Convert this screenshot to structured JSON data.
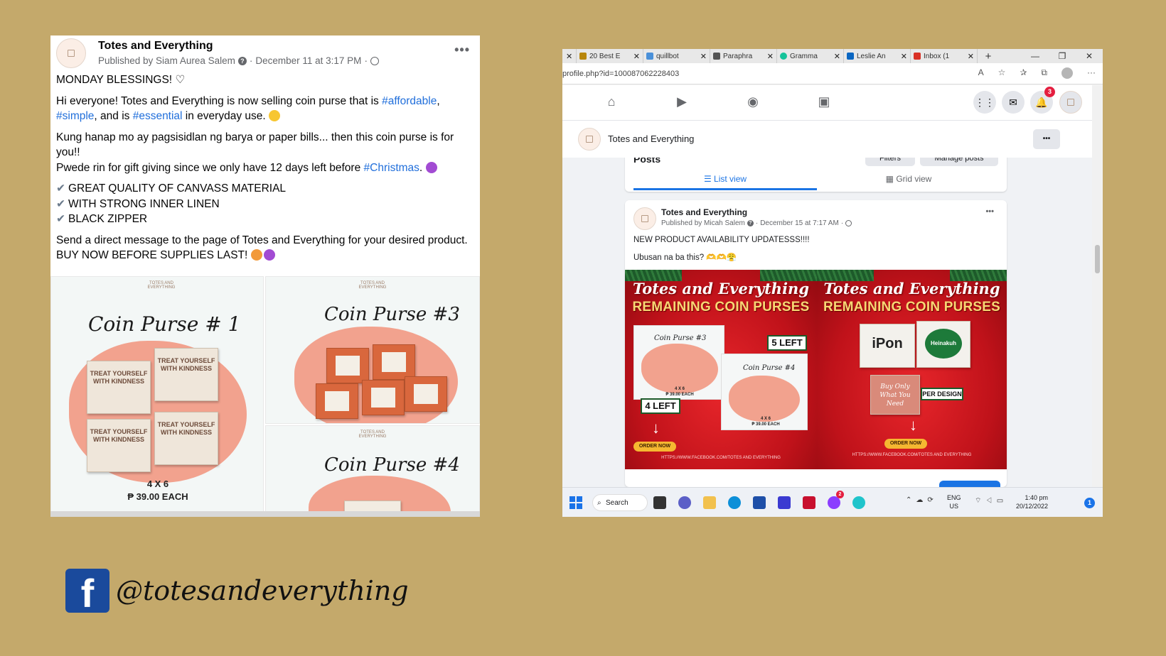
{
  "left_post": {
    "page_name": "Totes and Everything",
    "meta": "Published by Siam Aurea Salem",
    "date": "December 11 at 3:17 PM",
    "separator": "·",
    "more": "•••",
    "line_monday": "MONDAY BLESSINGS! ♡",
    "p1_a": "Hi everyone! Totes and Everything is now selling coin purse that is ",
    "p1_tag1": "#affordable",
    "p1_b": ", ",
    "p1_tag2": "#simple",
    "p1_c": ", and is ",
    "p1_tag3": "#essential",
    "p1_d": " in everyday use. ",
    "p2": "Kung hanap mo ay pagsisidlan ng barya or paper bills... then this coin purse is for you!!",
    "p3_a": "Pwede rin for gift giving since we only have 12 days left before ",
    "p3_tag": "#Christmas",
    "p3_b": ". ",
    "check_mark": "✔",
    "features": [
      "GREAT QUALITY OF CANVASS MATERIAL",
      "WITH STRONG INNER LINEN",
      "BLACK ZIPPER"
    ],
    "p4": "Send a direct message to the page of Totes and Everything for your desired product. BUY NOW BEFORE SUPPLIES LAST! ",
    "tiles": {
      "t1_title": "Coin Purse # 1",
      "t1_size": "4 X 6",
      "t1_price": "₱ 39.00 EACH",
      "t3_title": "Coin Purse #3",
      "t4_title": "Coin Purse #4",
      "logo_text": "TOTES AND EVERYTHING",
      "pouch_text": "TREAT YOURSELF WITH KINDNESS"
    }
  },
  "browser": {
    "tabs": [
      {
        "label": "20 Best E",
        "color": "#b8860b"
      },
      {
        "label": "quillbot",
        "color": "#4a90d9"
      },
      {
        "label": "Paraphra",
        "color": "#555555"
      },
      {
        "label": "Gramma",
        "color": "#15c39a"
      },
      {
        "label": "Leslie An",
        "color": "#0a66c2"
      },
      {
        "label": "Inbox (1",
        "color": "#d93025"
      }
    ],
    "tab_close": "✕",
    "new_tab": "+",
    "win_min": "—",
    "win_max": "❐",
    "win_close": "✕",
    "url": "profile.php?id=100087062228403",
    "notif_count": "3",
    "page_name": "Totes and Everything",
    "more": "•••",
    "posts_heading": "Posts",
    "filters_label": "Filters",
    "manage_posts_label": "Manage posts",
    "list_view_label": "List view",
    "grid_view_label": "Grid view",
    "post": {
      "page_name": "Totes and Everything",
      "meta": "Published by Micah Salem",
      "date": "December 15 at 7:17 AM",
      "separator": "·",
      "more": "•••",
      "line1": "NEW PRODUCT AVAILABILITY UPDATESSS!!!!",
      "line2": "Ubusan na ba this? 🫶🫶😤"
    },
    "promo": {
      "title": "Totes and Everything",
      "subtitle": "REMAINING COIN PURSES",
      "left_5": "5 LEFT",
      "left_4": "4 LEFT",
      "per_design": "PER DESIGN",
      "order_now": "ORDER NOW",
      "url_text": "HTTPS://WWW.FACEBOOK.COM/TOTES AND EVERYTHING",
      "card_cp3": "Coin Purse #3",
      "card_cp4": "Coin Purse #4",
      "card_size": "4 X 6",
      "card_price": "₱ 39.00 EACH",
      "ipon_label": "iPon",
      "heinakuh_label": "Heinakuh",
      "buy_label": "Buy Only What You Need"
    },
    "taskbar": {
      "search_label": "Search",
      "lang_1": "ENG",
      "lang_2": "US",
      "time": "1:40 pm",
      "date": "20/12/2022",
      "messenger_badge": "2",
      "notif": "1"
    }
  },
  "footer": {
    "fb_letter": "f",
    "handle": "@totesandeverything"
  }
}
